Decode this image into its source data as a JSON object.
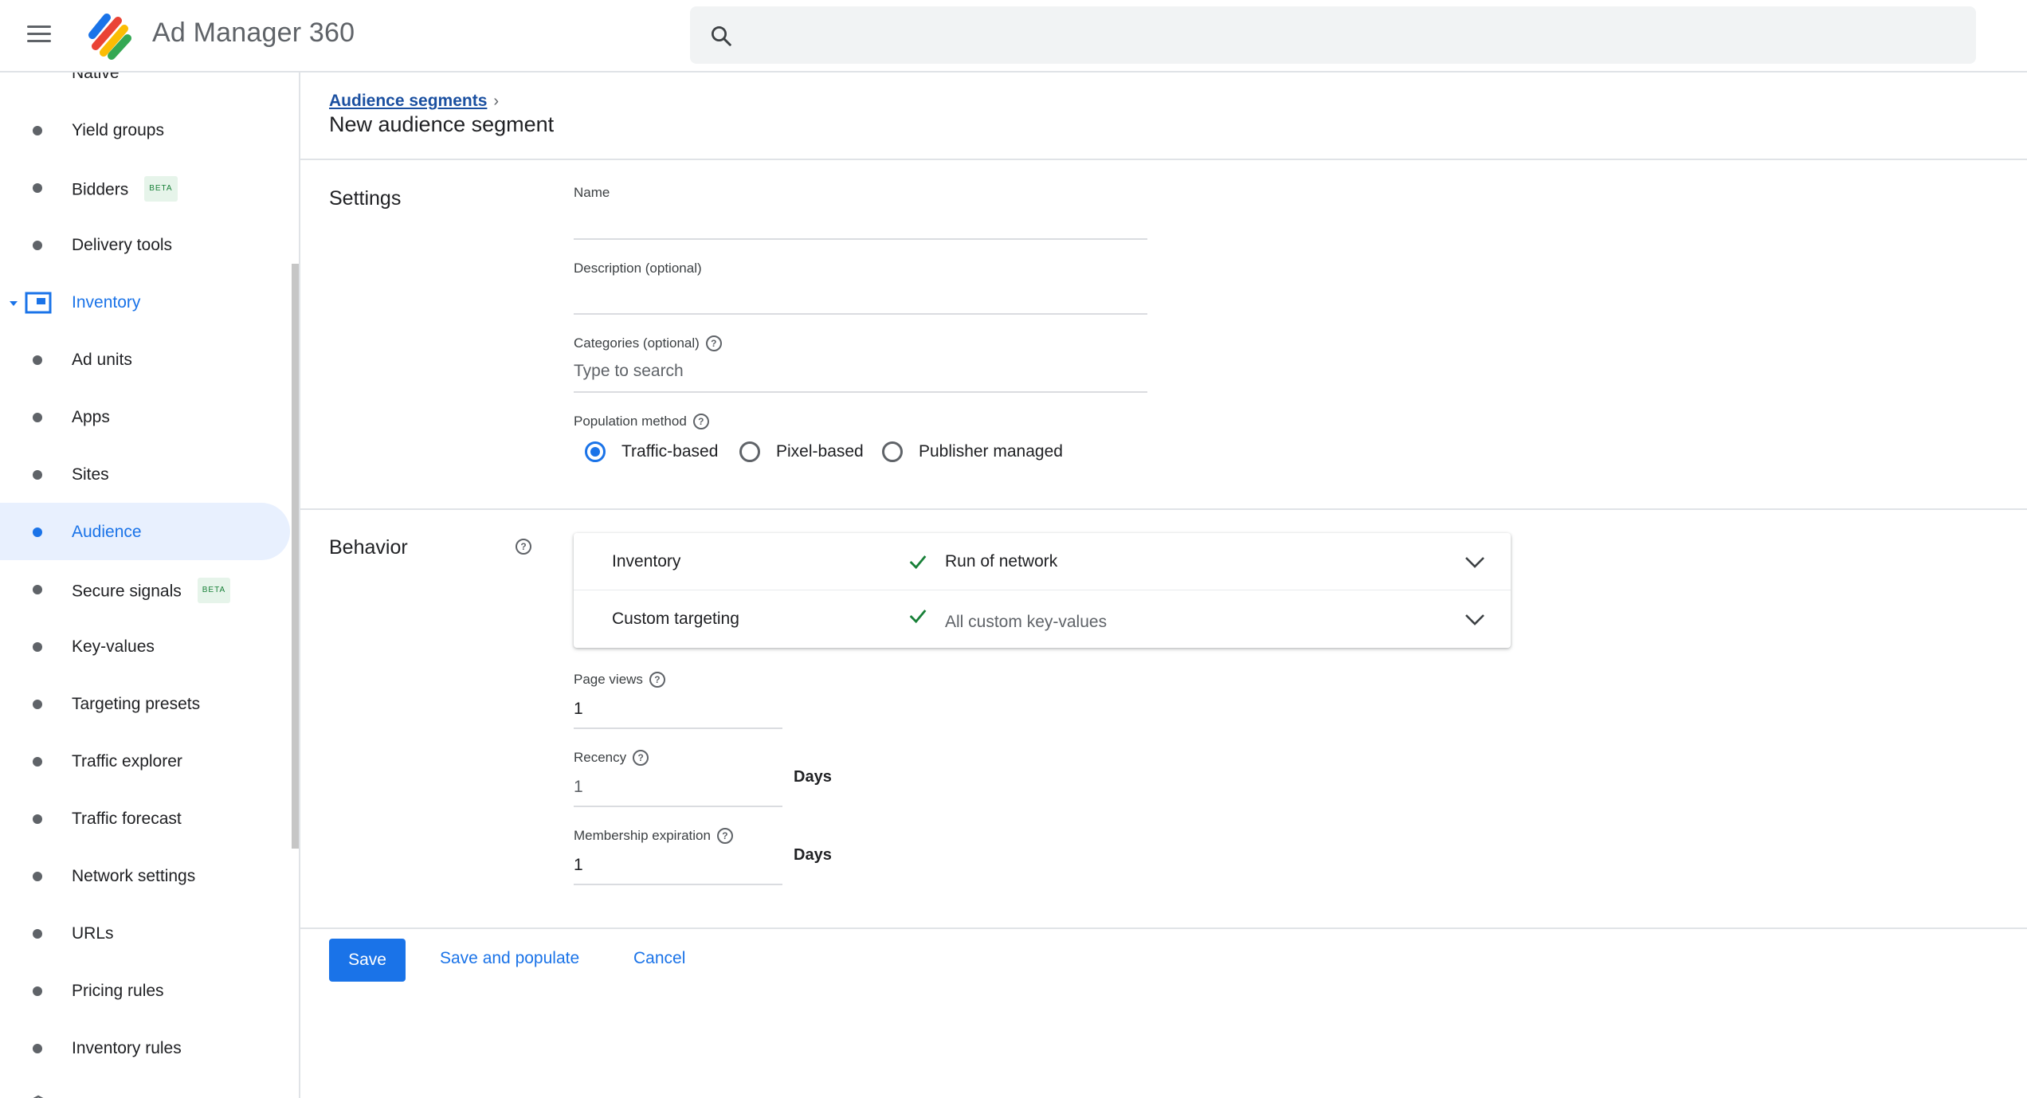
{
  "header": {
    "app_title": "Ad Manager 360",
    "search_placeholder": ""
  },
  "sidebar": {
    "clipped_top_label": "Native",
    "items_before": [
      {
        "label": "Yield groups",
        "beta": false
      },
      {
        "label": "Bidders",
        "beta": true
      },
      {
        "label": "Delivery tools",
        "beta": false
      }
    ],
    "section": {
      "label": "Inventory",
      "expanded": true
    },
    "items_after": [
      {
        "label": "Ad units",
        "beta": false,
        "active": false
      },
      {
        "label": "Apps",
        "beta": false,
        "active": false
      },
      {
        "label": "Sites",
        "beta": false,
        "active": false
      },
      {
        "label": "Audience",
        "beta": false,
        "active": true
      },
      {
        "label": "Secure signals",
        "beta": true,
        "active": false
      },
      {
        "label": "Key-values",
        "beta": false,
        "active": false
      },
      {
        "label": "Targeting presets",
        "beta": false,
        "active": false
      },
      {
        "label": "Traffic explorer",
        "beta": false,
        "active": false
      },
      {
        "label": "Traffic forecast",
        "beta": false,
        "active": false
      },
      {
        "label": "Network settings",
        "beta": false,
        "active": false
      },
      {
        "label": "URLs",
        "beta": false,
        "active": false
      },
      {
        "label": "Pricing rules",
        "beta": false,
        "active": false
      },
      {
        "label": "Inventory rules",
        "beta": false,
        "active": false
      }
    ],
    "beta_label": "BETA"
  },
  "main": {
    "breadcrumb": "Audience segments",
    "title": "New audience segment",
    "settings": {
      "title": "Settings",
      "name_label": "Name",
      "name_value": "",
      "description_label": "Description (optional)",
      "description_value": "",
      "categories_label": "Categories (optional)",
      "categories_placeholder": "Type to search",
      "population_label": "Population method",
      "population_options": [
        "Traffic-based",
        "Pixel-based",
        "Publisher managed"
      ],
      "population_selected": "Traffic-based"
    },
    "behavior": {
      "title": "Behavior",
      "targeting": [
        {
          "name": "Inventory",
          "value": "Run of network"
        },
        {
          "name": "Custom targeting",
          "value": "All custom key-values"
        }
      ],
      "page_views_label": "Page views",
      "page_views_value": "1",
      "recency_label": "Recency",
      "recency_placeholder": "1",
      "recency_unit": "Days",
      "membership_label": "Membership expiration",
      "membership_value": "1",
      "membership_unit": "Days"
    },
    "actions": {
      "save": "Save",
      "save_populate": "Save and populate",
      "cancel": "Cancel"
    }
  },
  "colors": {
    "accent": "#1a73e8",
    "active_bg": "#e8f0fe",
    "check_green": "#188038",
    "beta_green": "#188038"
  }
}
